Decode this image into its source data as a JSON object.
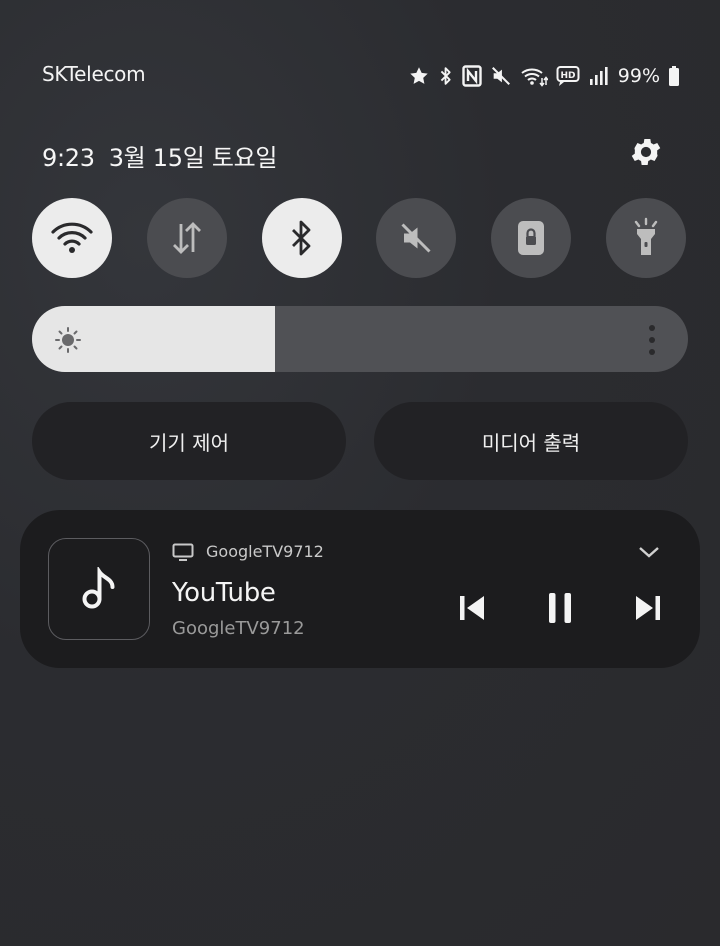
{
  "status_bar": {
    "carrier": "SKTelecom",
    "battery_percent": "99%",
    "icons": [
      "star-icon",
      "bluetooth-icon",
      "nfc-icon",
      "mute-icon",
      "wifi-activity-icon",
      "hd-voice-icon",
      "signal-icon",
      "battery-icon"
    ]
  },
  "header": {
    "time": "9:23",
    "date": "3월 15일 토요일",
    "settings_icon": "gear-icon"
  },
  "quick_toggles": [
    {
      "name": "wifi",
      "icon": "wifi-icon",
      "state": "on"
    },
    {
      "name": "mobile-data",
      "icon": "data-transfer-icon",
      "state": "off"
    },
    {
      "name": "bluetooth",
      "icon": "bluetooth-icon",
      "state": "on"
    },
    {
      "name": "sound",
      "icon": "mute-icon",
      "state": "off"
    },
    {
      "name": "screen-lock",
      "icon": "lock-icon",
      "state": "off"
    },
    {
      "name": "flashlight",
      "icon": "flashlight-icon",
      "state": "off"
    }
  ],
  "brightness": {
    "level": 0.37,
    "icon": "sun-icon",
    "more_icon": "more-vertical-icon"
  },
  "buttons": {
    "device_control": "기기 제어",
    "media_output": "미디어 출력"
  },
  "media": {
    "device": "GoogleTV9712",
    "app": "YouTube",
    "source": "GoogleTV9712",
    "icons": [
      "music-note-icon",
      "tv-icon",
      "chevron-down-icon",
      "skip-previous-icon",
      "pause-icon",
      "skip-next-icon"
    ]
  },
  "colors": {
    "toggle_on": "#ececec",
    "toggle_off": "#4b4c50",
    "card": "#1c1c1e"
  }
}
